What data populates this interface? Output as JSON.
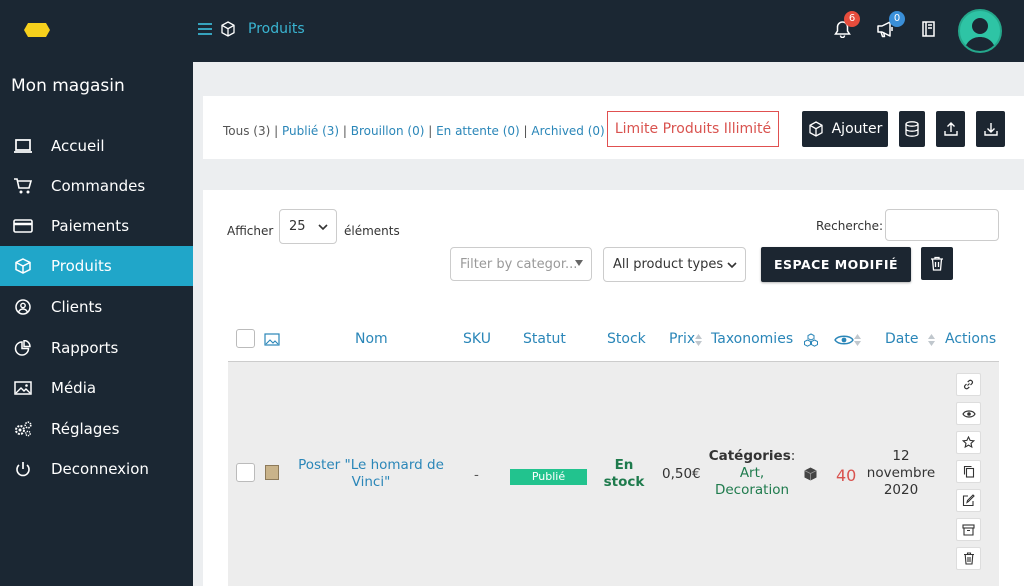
{
  "header": {
    "breadcrumb": "Produits",
    "notifications_count": "6",
    "announcements_count": "0",
    "colors": {
      "bar": "#1b2733",
      "accent": "#3ab5d2",
      "badge_red": "#e74c3c",
      "badge_blue": "#3a8fd8"
    }
  },
  "sidebar": {
    "store_name": "Mon magasin",
    "items": [
      {
        "label": "Accueil",
        "icon": "laptop-icon"
      },
      {
        "label": "Commandes",
        "icon": "cart-icon"
      },
      {
        "label": "Paiements",
        "icon": "credit-card-icon"
      },
      {
        "label": "Produits",
        "icon": "cube-icon",
        "active": true
      },
      {
        "label": "Clients",
        "icon": "user-circle-icon"
      },
      {
        "label": "Rapports",
        "icon": "pie-chart-icon"
      },
      {
        "label": "Média",
        "icon": "image-icon"
      },
      {
        "label": "Réglages",
        "icon": "gears-icon"
      },
      {
        "label": "Deconnexion",
        "icon": "power-icon"
      }
    ]
  },
  "filters": {
    "all": "Tous (3)",
    "published": "Publié (3)",
    "draft": "Brouillon (0)",
    "pending": "En attente (0)",
    "archived": "Archived (0)"
  },
  "toolbar": {
    "limit_label": "Limite Produits Illimité",
    "add_label": "Ajouter"
  },
  "table_controls": {
    "show_label": "Afficher",
    "page_size": "25",
    "elements_label": "éléments",
    "search_label": "Recherche:",
    "category_placeholder": "Filter by categor...",
    "product_type": "All product types",
    "espace_label": "ESPACE MODIFIÉ"
  },
  "columns": {
    "nom": "Nom",
    "sku": "SKU",
    "statut": "Statut",
    "stock": "Stock",
    "prix": "Prix",
    "taxonomies": "Taxonomies",
    "date": "Date",
    "actions": "Actions"
  },
  "row": {
    "name_line1": "Poster \"Le homard de",
    "name_line2": "Vinci\"",
    "sku": "-",
    "status": "Publié",
    "stock_line1": "En",
    "stock_line2": "stock",
    "price": "0,50€",
    "categories_label": "Catégories",
    "cat1": "Art,",
    "cat2": "Decoration",
    "views": "40",
    "date_line1": "12",
    "date_line2": "novembre",
    "date_line3": "2020"
  },
  "actions": [
    "link-icon",
    "eye-icon",
    "star-icon",
    "copy-icon",
    "edit-icon",
    "archive-icon",
    "trash-icon"
  ]
}
